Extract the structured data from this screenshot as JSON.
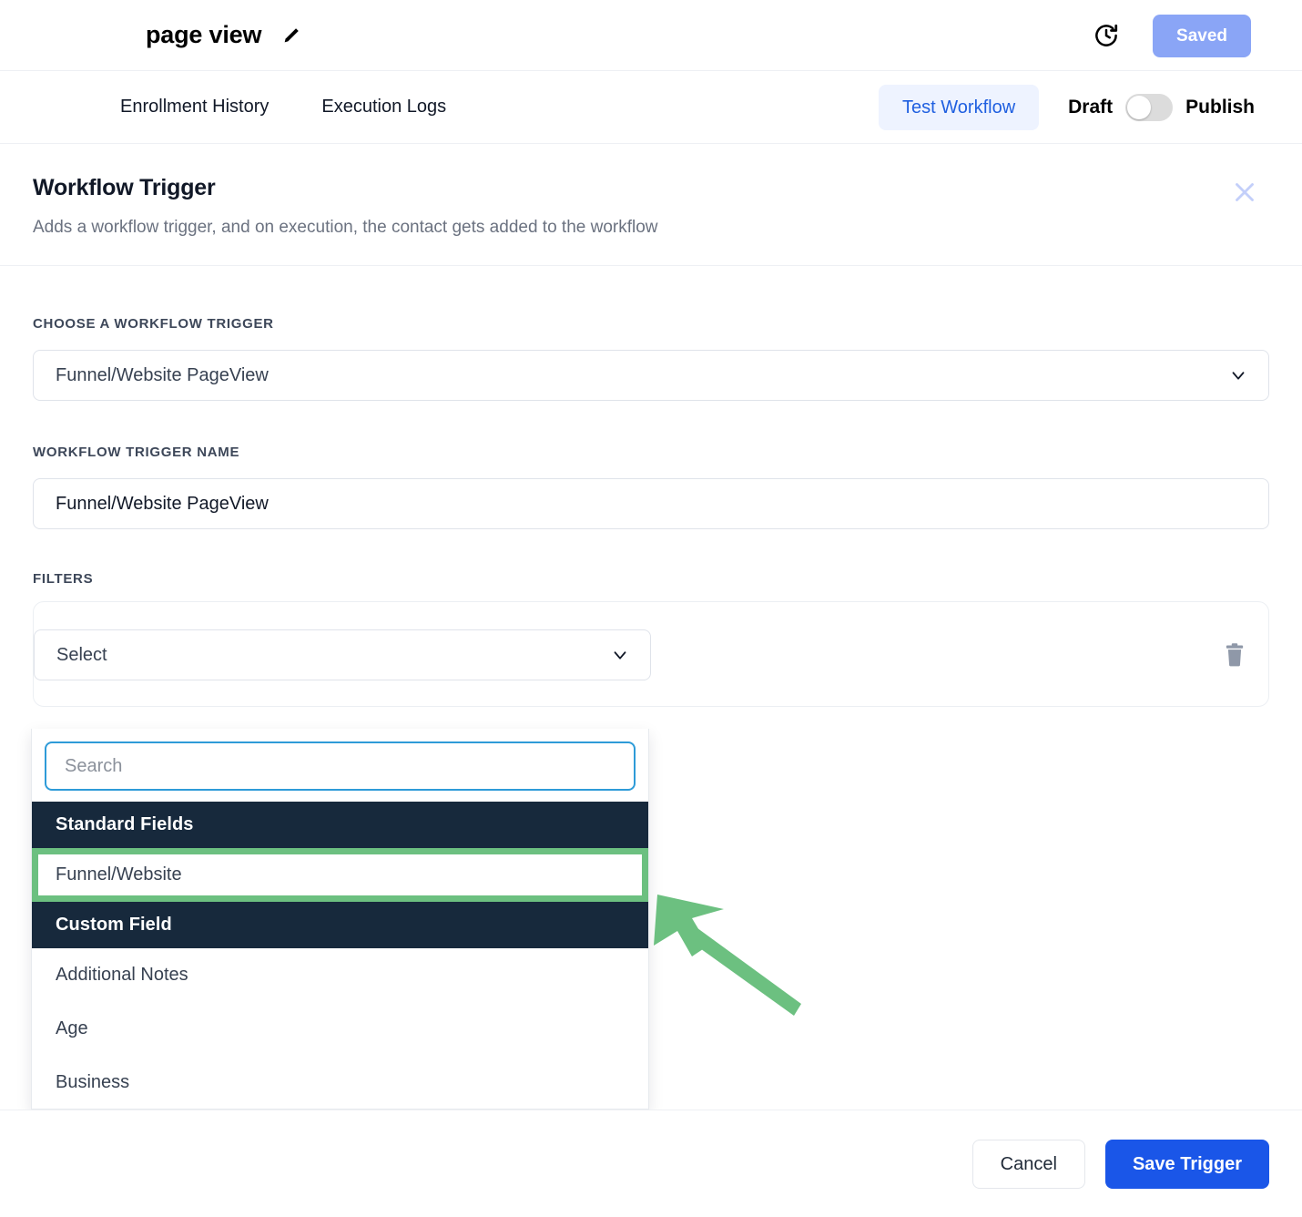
{
  "header": {
    "workflow_name": "page view",
    "edit_icon": "pencil-icon",
    "history_icon": "history-clock-icon",
    "saved_label": "Saved",
    "saved_color": "#8aa5f6"
  },
  "tabs": {
    "items": [
      {
        "label": "Enrollment History"
      },
      {
        "label": "Execution Logs"
      }
    ],
    "test_workflow_label": "Test Workflow",
    "test_workflow_color": "#1f5fe0",
    "draft_label": "Draft",
    "publish_label": "Publish",
    "toggle_state": "draft"
  },
  "panel": {
    "title": "Workflow Trigger",
    "subtitle": "Adds a workflow trigger, and on execution, the contact gets added to the workflow",
    "close_icon": "close-x-icon"
  },
  "form": {
    "trigger_label": "CHOOSE A WORKFLOW TRIGGER",
    "trigger_value": "Funnel/Website PageView",
    "name_label": "WORKFLOW TRIGGER NAME",
    "name_value": "Funnel/Website PageView",
    "filters_label": "FILTERS",
    "filter_select_value": "Select",
    "delete_icon": "trash-icon"
  },
  "dropdown": {
    "search_placeholder": "Search",
    "search_value": "",
    "groups": [
      {
        "header": "Standard Fields",
        "options": [
          {
            "label": "Funnel/Website",
            "highlighted": true
          }
        ]
      },
      {
        "header": "Custom Field",
        "options": [
          {
            "label": "Additional Notes",
            "highlighted": false
          },
          {
            "label": "Age",
            "highlighted": false
          },
          {
            "label": "Business",
            "highlighted": false
          }
        ]
      }
    ],
    "highlight_color": "#6cc080",
    "group_header_color": "#17293c"
  },
  "annotation": {
    "arrow_color": "#6cc080",
    "points_to": "Funnel/Website"
  },
  "footer": {
    "cancel_label": "Cancel",
    "save_label": "Save Trigger",
    "save_color": "#1a56e8"
  }
}
